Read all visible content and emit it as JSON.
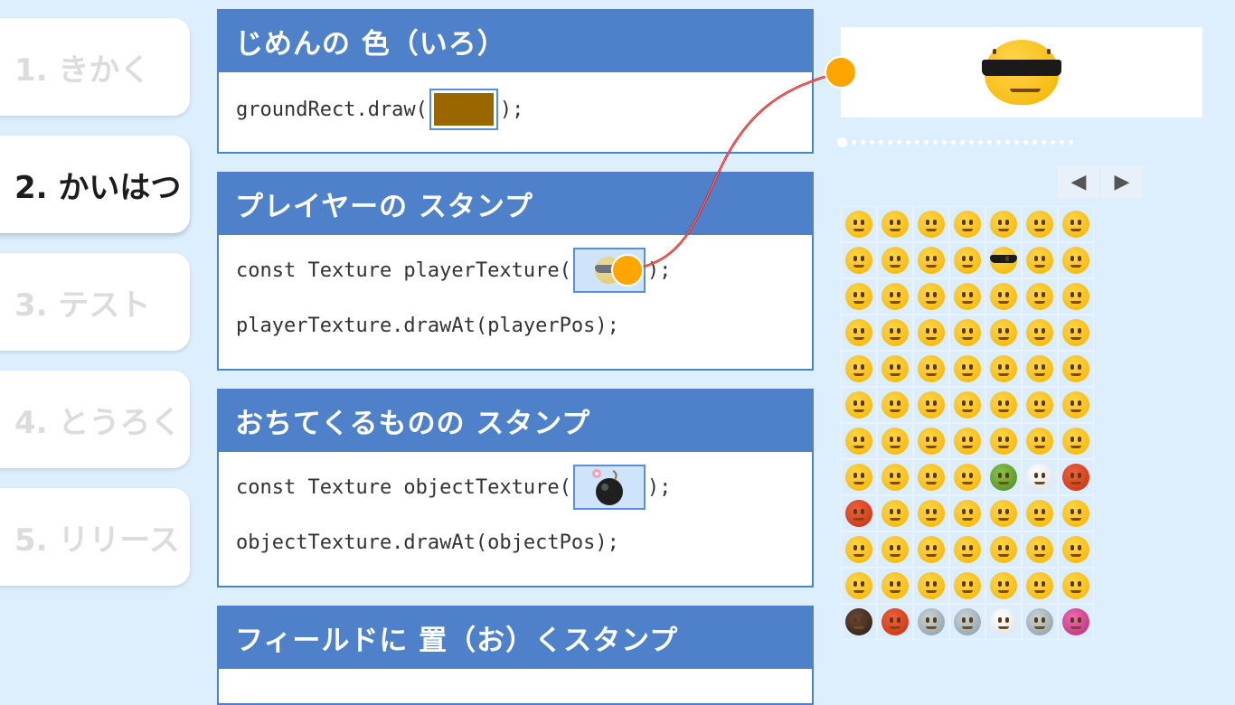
{
  "steps": [
    {
      "label": "1. きかく",
      "active": false
    },
    {
      "label": "2. かいはつ",
      "active": true
    },
    {
      "label": "3. テスト",
      "active": false
    },
    {
      "label": "4. とうろく",
      "active": false
    },
    {
      "label": "5. リリース",
      "active": false
    }
  ],
  "panels": {
    "ground": {
      "title": "じめんの 色（いろ）",
      "code_prefix": "groundRect.draw(",
      "code_suffix": ");",
      "color": "#996600"
    },
    "player": {
      "title": "プレイヤーの スタンプ",
      "line1_prefix": "const Texture playerTexture(",
      "line1_suffix": ");",
      "line2": "playerTexture.drawAt(playerPos);",
      "stamp_icon": "sunglasses-face-emoji"
    },
    "object": {
      "title": "おちてくるものの スタンプ",
      "line1_prefix": "const Texture objectTexture(",
      "line1_suffix": ");",
      "line2": "objectTexture.drawAt(objectPos);",
      "stamp_icon": "bomb-emoji"
    },
    "field": {
      "title": "フィールドに 置（お）くスタンプ"
    }
  },
  "preview": {
    "icon": "sunglasses-face-emoji"
  },
  "pager": {
    "total_dots": 26,
    "current": 1,
    "prev_glyph": "◀",
    "next_glyph": "▶"
  },
  "palette": {
    "columns": 7,
    "rows": 12,
    "selected_icon": "sunglasses-face-emoji",
    "selected_index": 11
  },
  "colors": {
    "background": "#ddeefc",
    "panel_header": "#4f81cb",
    "connector_line": "#dd1111",
    "connector_knob": "#ffa500"
  }
}
